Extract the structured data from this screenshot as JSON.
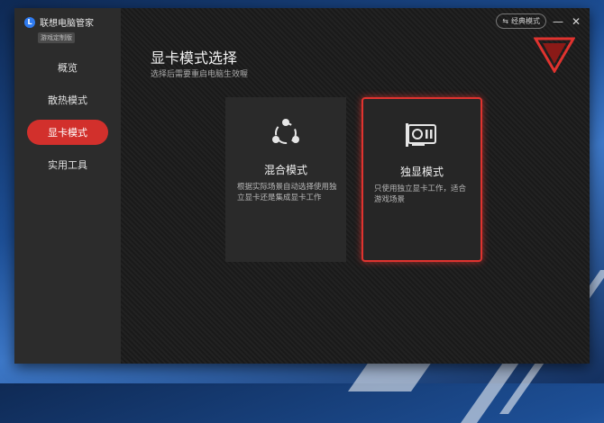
{
  "app": {
    "name": "联想电脑管家",
    "edition": "游戏定制版"
  },
  "sidebar": {
    "items": [
      {
        "label": "概览",
        "active": false
      },
      {
        "label": "散热模式",
        "active": false
      },
      {
        "label": "显卡模式",
        "active": true
      },
      {
        "label": "实用工具",
        "active": false
      }
    ]
  },
  "header": {
    "classic_mode_label": "经典模式",
    "minimize_symbol": "—",
    "close_symbol": "✕"
  },
  "main": {
    "title": "显卡模式选择",
    "subtitle": "选择后需要重启电脑生效喔",
    "cards": [
      {
        "title": "混合模式",
        "description": "根据实际场景自动选择使用独立显卡还是集成显卡工作",
        "icon": "hybrid-share-icon",
        "selected": false
      },
      {
        "title": "独显模式",
        "description": "只使用独立显卡工作，适合游戏场景",
        "icon": "graphics-card-icon",
        "selected": true
      }
    ]
  },
  "colors": {
    "accent": "#d2302c",
    "sidebar_bg": "#2c2c2c",
    "main_bg": "#1f1f1f",
    "desktop_blue": "#1d4f96"
  }
}
